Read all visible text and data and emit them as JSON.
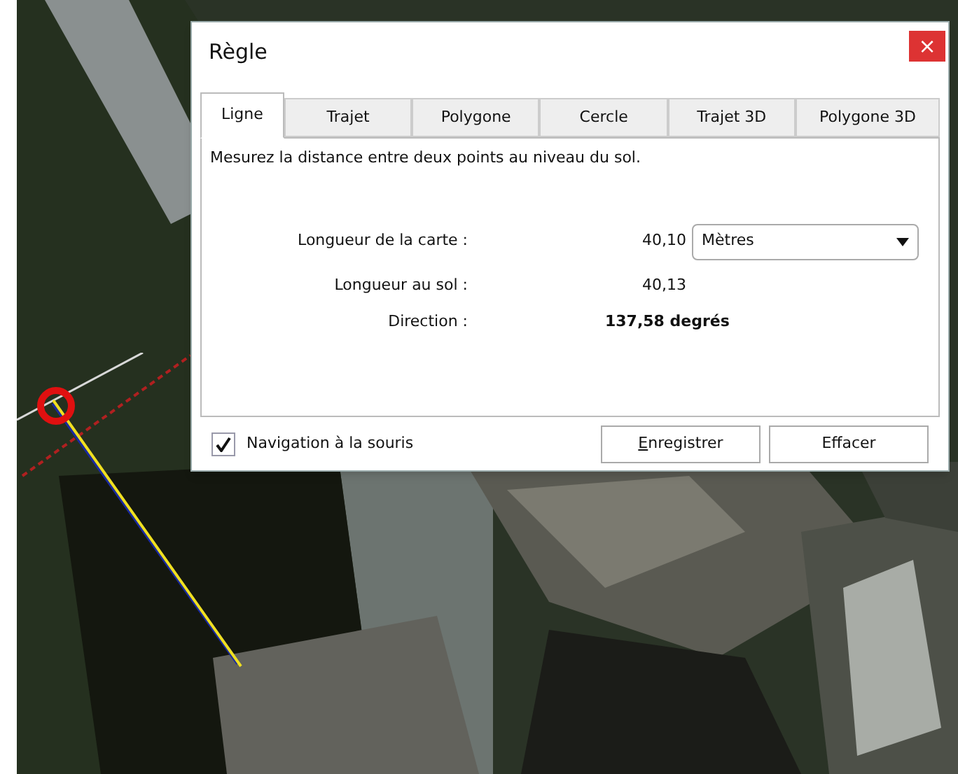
{
  "window": {
    "title": "Règle",
    "close": "×"
  },
  "tabs": [
    {
      "label": "Ligne",
      "selected": true
    },
    {
      "label": "Trajet",
      "selected": false
    },
    {
      "label": "Polygone",
      "selected": false
    },
    {
      "label": "Cercle",
      "selected": false
    },
    {
      "label": "Trajet 3D",
      "selected": false
    },
    {
      "label": "Polygone 3D",
      "selected": false
    }
  ],
  "description": "Mesurez la distance entre deux points au niveau du sol.",
  "measurements": [
    {
      "label": "Longueur de la carte :",
      "value": "40,10",
      "unit_select": "Mètres"
    },
    {
      "label": "Longueur au sol :",
      "value": "40,13"
    },
    {
      "label": "Direction :",
      "value": "137,58 degrés",
      "bold": true
    }
  ],
  "mouse_navigation": {
    "label": "Navigation à la souris",
    "checked": true
  },
  "buttons": [
    {
      "label": "Enregistrer",
      "underline_first": true
    },
    {
      "label": "Effacer"
    }
  ]
}
